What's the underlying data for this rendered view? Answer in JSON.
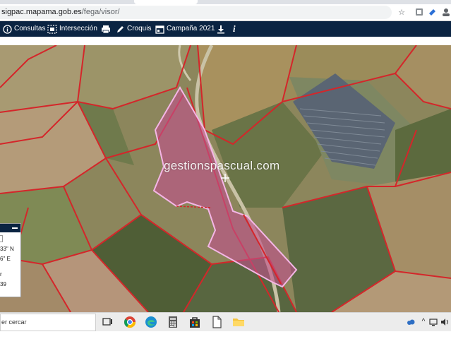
{
  "browser": {
    "url_host": "sigpac.mapama.gob.es",
    "url_path": "/fega/visor/",
    "icons": [
      "star-icon",
      "extension-icon",
      "edit-icon",
      "profile-icon"
    ]
  },
  "toolbar": {
    "items": [
      {
        "label": "Consultas",
        "icon": "info-icon"
      },
      {
        "label": "Intersección",
        "icon": "intersection-icon"
      },
      {
        "label": "",
        "icon": "print-icon"
      },
      {
        "label": "Croquis",
        "icon": "pencil-icon"
      },
      {
        "label": "Campaña 2021",
        "icon": "calendar-icon"
      },
      {
        "label": "",
        "icon": "download-icon"
      },
      {
        "label": "",
        "icon": "info-italic-icon"
      }
    ],
    "background": "#0b2442"
  },
  "map": {
    "watermark": "gestionspascual.com",
    "parcel_fill": "#c0508a",
    "parcel_stroke": "#f4b6e6",
    "boundary_color": "#d4262a"
  },
  "coords_panel": {
    "lines": [
      "33\" N",
      "6\" E",
      "r",
      "39"
    ]
  },
  "taskbar": {
    "search_text": "er cercar",
    "apps": [
      "task-view-icon",
      "chrome-icon",
      "edge-icon",
      "calculator-icon",
      "store-icon",
      "notepad-icon",
      "file-explorer-icon"
    ],
    "tray": [
      "cloud-icon",
      "chevron-up-icon",
      "network-icon",
      "volume-icon"
    ]
  }
}
